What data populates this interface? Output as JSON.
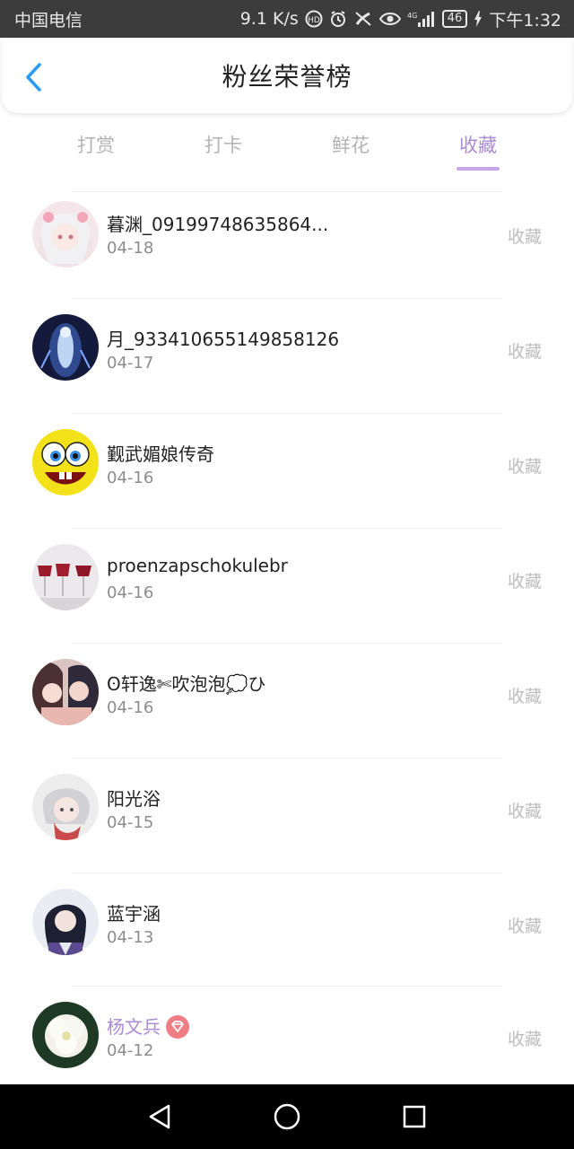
{
  "status_bar": {
    "carrier": "中国电信",
    "speed": "9.1 K/s",
    "battery": "46",
    "time": "下午1:32",
    "icons": [
      "hd-icon",
      "alarm-icon",
      "no-call-icon",
      "eye-icon",
      "4g-signal-icon",
      "charging-icon"
    ]
  },
  "header": {
    "title": "粉丝荣誉榜",
    "back_icon": "chevron-left-icon",
    "accent_color": "#2b9af3"
  },
  "tabs": [
    {
      "label": "打赏",
      "active": false
    },
    {
      "label": "打卡",
      "active": false
    },
    {
      "label": "鲜花",
      "active": false
    },
    {
      "label": "收藏",
      "active": true
    }
  ],
  "list": {
    "action_label": "收藏",
    "items": [
      {
        "name": "暮渊_09199748635864...",
        "date": "04-18",
        "avatar": "anime-girl-pink-avatar",
        "vip": false
      },
      {
        "name": "月_933410655149858126",
        "date": "04-17",
        "avatar": "dark-blue-glow-avatar",
        "vip": false
      },
      {
        "name": "觐武媚娘传奇",
        "date": "04-16",
        "avatar": "spongebob-avatar",
        "vip": false
      },
      {
        "name": "proenzapschokulebr",
        "date": "04-16",
        "avatar": "wine-glasses-avatar",
        "vip": false
      },
      {
        "name": "ʘ轩逸✄吹泡泡💭ひ",
        "date": "04-16",
        "avatar": "anime-couple-avatar",
        "vip": false
      },
      {
        "name": "阳光浴",
        "date": "04-15",
        "avatar": "anime-boy-white-hair-avatar",
        "vip": false
      },
      {
        "name": "蓝宇涵",
        "date": "04-13",
        "avatar": "anime-man-dark-hair-avatar",
        "vip": false
      },
      {
        "name": "杨文兵",
        "date": "04-12",
        "avatar": "white-flower-avatar",
        "vip": true
      }
    ]
  },
  "colors": {
    "active_tab": "#a98ad3",
    "inactive_tab": "#b3b3b3",
    "vip_badge": "#f07c84",
    "status_bar_bg": "#3c3c3c"
  },
  "nav_bar": {
    "icons": [
      "back-triangle-icon",
      "home-circle-icon",
      "recents-square-icon"
    ]
  }
}
